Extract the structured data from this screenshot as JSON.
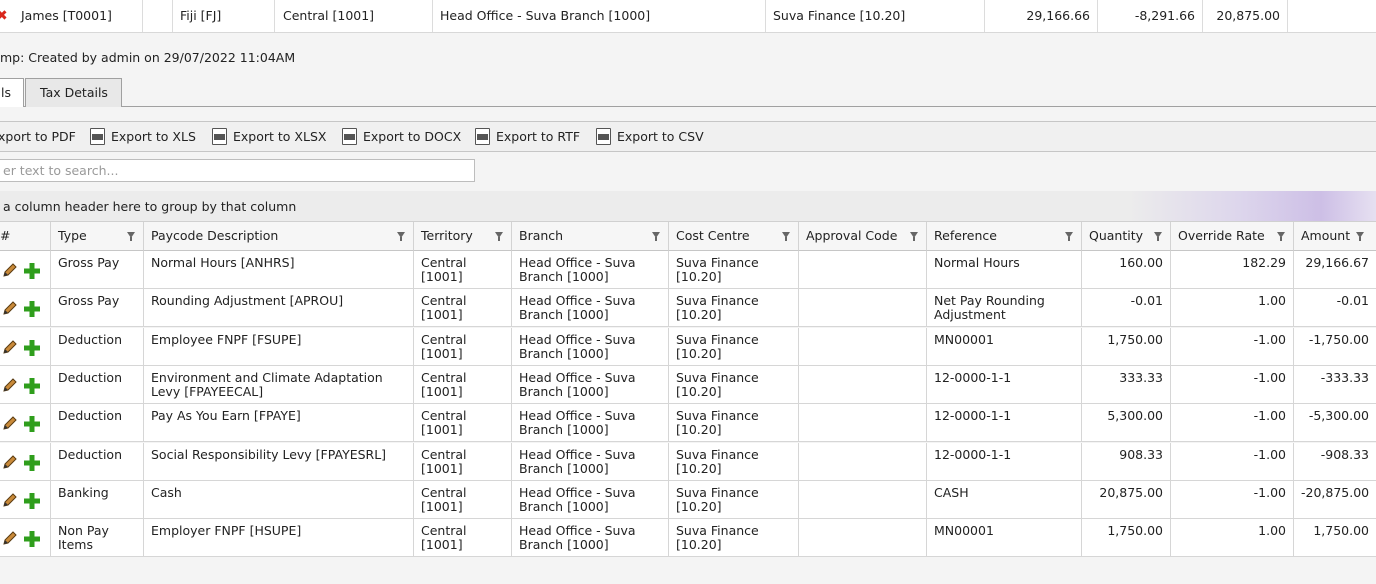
{
  "summary_row": {
    "employee": "James [T0001]",
    "country": "Fiji [FJ]",
    "territory": "Central [1001]",
    "branch": "Head Office - Suva Branch [1000]",
    "cost_centre": "Suva Finance [10.20]",
    "gross": "29,166.66",
    "deductions": "-8,291.66",
    "net": "20,875.00"
  },
  "timestamp": "mp: Created by admin on 29/07/2022 11:04AM",
  "tabs": [
    {
      "label": "ls"
    },
    {
      "label": "Tax Details"
    }
  ],
  "toolbar": {
    "exports": [
      {
        "label": "xport to PDF",
        "icon": "pdf"
      },
      {
        "label": "Export to XLS",
        "icon": "xls"
      },
      {
        "label": "Export to XLSX",
        "icon": "xlsx"
      },
      {
        "label": "Export to DOCX",
        "icon": "docx"
      },
      {
        "label": "Export to RTF",
        "icon": "rtf"
      },
      {
        "label": "Export to CSV",
        "icon": "csv"
      }
    ]
  },
  "search": {
    "placeholder": "er text to search..."
  },
  "group_panel": {
    "text": "a column header here to group by that column"
  },
  "columns": [
    "#",
    "Type",
    "Paycode Description",
    "Territory",
    "Branch",
    "Cost Centre",
    "Approval Code",
    "Reference",
    "Quantity",
    "Override Rate",
    "Amount"
  ],
  "rows": [
    {
      "type": "Gross Pay",
      "desc": "Normal Hours [ANHRS]",
      "territory": "Central [1001]",
      "branch": "Head Office - Suva Branch [1000]",
      "cost_centre": "Suva Finance [10.20]",
      "approval": "",
      "reference": "Normal Hours",
      "quantity": "160.00",
      "rate": "182.29",
      "amount": "29,166.67"
    },
    {
      "type": "Gross Pay",
      "desc": "Rounding Adjustment [APROU]",
      "territory": "Central [1001]",
      "branch": "Head Office - Suva Branch [1000]",
      "cost_centre": "Suva Finance [10.20]",
      "approval": "",
      "reference": "Net Pay Rounding Adjustment",
      "quantity": "-0.01",
      "rate": "1.00",
      "amount": "-0.01"
    },
    {
      "type": "Deduction",
      "desc": "Employee FNPF [FSUPE]",
      "territory": "Central [1001]",
      "branch": "Head Office - Suva Branch [1000]",
      "cost_centre": "Suva Finance [10.20]",
      "approval": "",
      "reference": "MN00001",
      "quantity": "1,750.00",
      "rate": "-1.00",
      "amount": "-1,750.00"
    },
    {
      "type": "Deduction",
      "desc": "Environment and Climate Adaptation Levy [FPAYEECAL]",
      "territory": "Central [1001]",
      "branch": "Head Office - Suva Branch [1000]",
      "cost_centre": "Suva Finance [10.20]",
      "approval": "",
      "reference": "12-0000-1-1",
      "quantity": "333.33",
      "rate": "-1.00",
      "amount": "-333.33"
    },
    {
      "type": "Deduction",
      "desc": "Pay As You Earn [FPAYE]",
      "territory": "Central [1001]",
      "branch": "Head Office - Suva Branch [1000]",
      "cost_centre": "Suva Finance [10.20]",
      "approval": "",
      "reference": "12-0000-1-1",
      "quantity": "5,300.00",
      "rate": "-1.00",
      "amount": "-5,300.00"
    },
    {
      "type": "Deduction",
      "desc": "Social Responsibility Levy [FPAYESRL]",
      "territory": "Central [1001]",
      "branch": "Head Office - Suva Branch [1000]",
      "cost_centre": "Suva Finance [10.20]",
      "approval": "",
      "reference": "12-0000-1-1",
      "quantity": "908.33",
      "rate": "-1.00",
      "amount": "-908.33"
    },
    {
      "type": "Banking",
      "desc": "Cash",
      "territory": "Central [1001]",
      "branch": "Head Office - Suva Branch [1000]",
      "cost_centre": "Suva Finance [10.20]",
      "approval": "",
      "reference": "CASH",
      "quantity": "20,875.00",
      "rate": "-1.00",
      "amount": "-20,875.00"
    },
    {
      "type": "Non Pay Items",
      "desc": "Employer FNPF [HSUPE]",
      "territory": "Central [1001]",
      "branch": "Head Office - Suva Branch [1000]",
      "cost_centre": "Suva Finance [10.20]",
      "approval": "",
      "reference": "MN00001",
      "quantity": "1,750.00",
      "rate": "1.00",
      "amount": "1,750.00"
    }
  ]
}
